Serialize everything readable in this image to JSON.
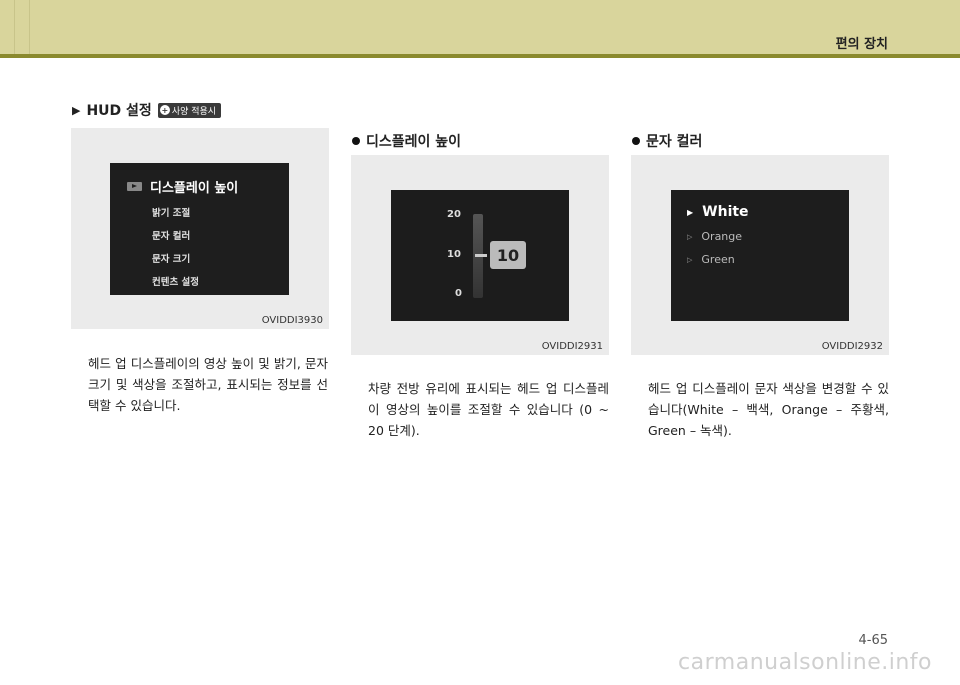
{
  "header": {
    "section_title": "편의 장치"
  },
  "hud": {
    "title": "HUD 설정",
    "badge": "사양 적용시",
    "badge_icon": "option-icon"
  },
  "figure1": {
    "menu_title": "디스플레이 높이",
    "menu_items": [
      "밝기 조절",
      "문자 컬러",
      "문자 크기",
      "컨텐츠 설정"
    ],
    "code": "OVIDDI3930"
  },
  "col1": {
    "text": "헤드 업 디스플레이의 영상 높이 및 밝기, 문자 크기 및 색상을 조절하고, 표시되는 정보를 선택할 수 있습니다."
  },
  "col2": {
    "heading": "디스플레이 높이",
    "scale_labels": [
      "20",
      "10",
      "0"
    ],
    "current_value": "10",
    "code": "OVIDDI2931",
    "text": "차량 전방 유리에 표시되는 헤드 업 디스플레이 영상의 높이를 조절할 수 있습니다 (0 ~ 20 단계)."
  },
  "col3": {
    "heading": "문자 컬러",
    "colors": [
      "White",
      "Orange",
      "Green"
    ],
    "selected": "White",
    "code": "OVIDDI2932",
    "text": "헤드 업 디스플레이 문자 색상을 변경할 수 있습니다(White – 백색, Orange – 주황색, Green – 녹색)."
  },
  "footer": {
    "page_number": "4-65",
    "watermark": "carmanualsonline.info"
  }
}
